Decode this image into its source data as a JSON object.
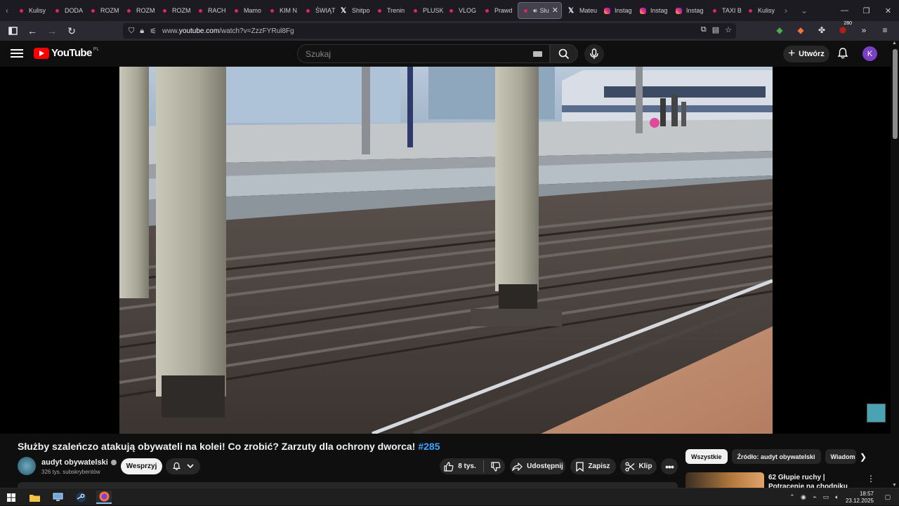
{
  "browser": {
    "tabs": [
      {
        "label": "Kulisy",
        "icon": "youtube-icon"
      },
      {
        "label": "DODA",
        "icon": "youtube-icon"
      },
      {
        "label": "ROZM",
        "icon": "youtube-icon"
      },
      {
        "label": "ROZM",
        "icon": "youtube-icon"
      },
      {
        "label": "ROZM",
        "icon": "youtube-icon"
      },
      {
        "label": "RACH",
        "icon": "youtube-icon"
      },
      {
        "label": "Mamo",
        "icon": "youtube-icon"
      },
      {
        "label": "KIM N",
        "icon": "youtube-icon"
      },
      {
        "label": "ŚWIĄT",
        "icon": "youtube-icon"
      },
      {
        "label": "Shitpo",
        "icon": "x-icon"
      },
      {
        "label": "Trenin",
        "icon": "youtube-icon"
      },
      {
        "label": "PLUSK",
        "icon": "youtube-icon"
      },
      {
        "label": "VLOG",
        "icon": "youtube-icon"
      },
      {
        "label": "Prawd",
        "icon": "youtube-icon"
      },
      {
        "label": "Słu",
        "icon": "youtube-icon",
        "active": true
      },
      {
        "label": "Mateu",
        "icon": "x-icon"
      },
      {
        "label": "Instag",
        "icon": "instagram-icon"
      },
      {
        "label": "Instag",
        "icon": "instagram-icon"
      },
      {
        "label": "Instag",
        "icon": "instagram-icon"
      },
      {
        "label": "TAXI B",
        "icon": "youtube-icon"
      },
      {
        "label": "Kulisy",
        "icon": "youtube-icon"
      }
    ],
    "url_prefix": "www.",
    "url_host": "youtube.com",
    "url_path": "/watch?v=ZzzFYRul8Fg",
    "extension_badge": "280"
  },
  "youtube": {
    "logo_text": "YouTube",
    "country_code": "PL",
    "search_placeholder": "Szukaj",
    "create_label": "Utwórz",
    "avatar_letter": "K"
  },
  "video": {
    "title": "Służby szaleńczo atakują obywateli na kolei! Co zrobić? Zarzuty dla ochrony dworca!",
    "hashtag": "#285",
    "channel_name": "audyt obywatelski",
    "subscribers": "326 tys. subskrybentów",
    "support_label": "Wesprzyj",
    "likes": "8 tys.",
    "share_label": "Udostępnij",
    "save_label": "Zapisz",
    "clip_label": "Klip"
  },
  "recommendations": {
    "chips": [
      "Wszystkie",
      "Źródło: audyt obywatelski",
      "Wiadom"
    ],
    "first_title": "62 Głupie ruchy | Potrącenie na chodniku"
  },
  "taskbar": {
    "time": "18:57",
    "date": "23.12.2025"
  },
  "colors": {
    "youtube_red": "#ff0000",
    "hashtag_blue": "#3ea6ff",
    "avatar_purple": "#7b3fc4"
  }
}
